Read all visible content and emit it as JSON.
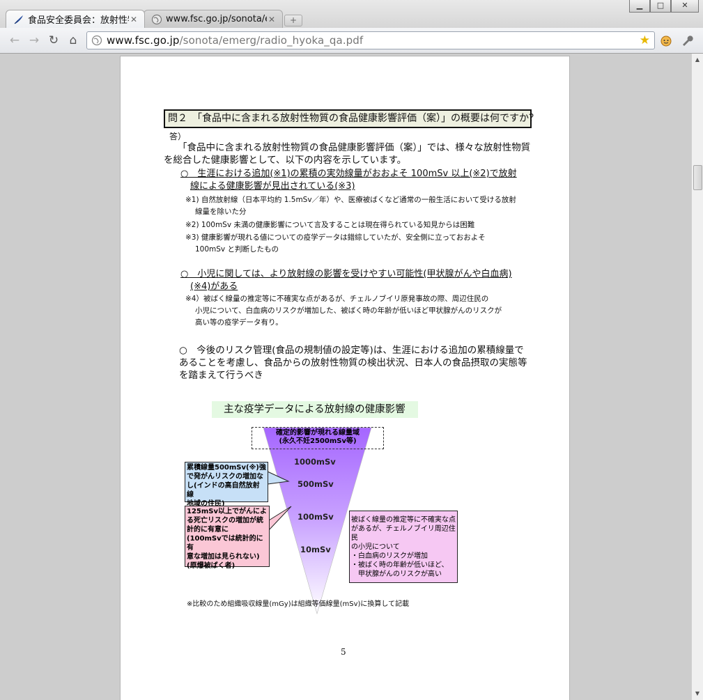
{
  "browser": {
    "tabs": [
      {
        "label": "食品安全委員会：放射性物",
        "active": true
      },
      {
        "label": "www.fsc.go.jp/sonota/er",
        "active": false
      }
    ],
    "url_domain": "www.fsc.go.jp",
    "url_path": "/sonota/emerg/radio_hyoka_qa.pdf",
    "window_buttons": {
      "minimize": "▁",
      "maximize": "□",
      "close": "✕"
    }
  },
  "document": {
    "question": "問２　「食品中に含まれる放射性物質の食品健康影響評価（案）」の概要は何ですか？",
    "answer_label": "答）",
    "intro": "「食品中に含まれる放射性物質の食品健康影響評価（案）」では、様々な放射性物質を総合した健康影響として、以下の内容を示しています。",
    "bullet1_line1": "○　生涯における追加(※1)の累積の実効線量がおおよそ 100mSv 以上(※2)で放射",
    "bullet1_line2": "線による健康影響が見出されている(※3)",
    "note1_line1": "※1) 自然放射線（日本平均約 1.5mSv／年）や、医療被ばくなど通常の一般生活において受ける放射",
    "note1_line2": "線量を除いた分",
    "note2": "※2) 100mSv 未満の健康影響について言及することは現在得られている知見からは困難",
    "note3_line1": "※3) 健康影響が現れる値についての疫学データは錯綜していたが、安全側に立っておおよそ",
    "note3_line2": "100mSv と判断したもの",
    "bullet2_line1": "○　小児に関しては、より放射線の影響を受けやすい可能性(甲状腺がんや白血病)",
    "bullet2_line2": "(※4)がある",
    "note4_line1": "※4）被ばく線量の推定等に不確実な点があるが、チェルノブイリ原発事故の際、周辺住民の",
    "note4_line2": "小児について、白血病のリスクが増加した、被ばく時の年齢が低いほど甲状腺がんのリスクが",
    "note4_line3": "高い等の疫学データ有り。",
    "bullet3": "○　今後のリスク管理(食品の規制値の設定等)は、生涯における追加の累積線量であることを考慮し、食品からの放射性物質の検出状況、日本人の食品摂取の実態等を踏まえて行うべき",
    "chart_title": "主な疫学データによる放射線の健康影響",
    "deterministic_line1": "確定的影響が現れる線量域",
    "deterministic_line2": "(永久不妊2500mSv等)",
    "doses": [
      "1000mSv",
      "500mSv",
      "100mSv",
      "10mSv"
    ],
    "callout_blue": [
      "累積線量500mSv(※)強",
      "で発がんリスクの増加な",
      "し(インドの高自然放射線",
      "地域の住民)"
    ],
    "callout_pink": [
      "125mSv以上でがんによ",
      "る死亡リスクの増加が統",
      "計的に有意に",
      "(100mSvでは統計的に有",
      "意な増加は見られない)",
      "(原爆被ばく者)"
    ],
    "callout_lilac": [
      "被ばく線量の推定等に不確実な点",
      "があるが、チェルノブイリ周辺住民",
      "の小児について",
      "・白血病のリスクが増加",
      "・被ばく時の年齢が低いほど、",
      "　甲状腺がんのリスクが高い"
    ],
    "footnote": "※比較のため組織吸収線量(mGy)は組織等価線量(mSv)に換算して記載",
    "page_number": "5"
  }
}
